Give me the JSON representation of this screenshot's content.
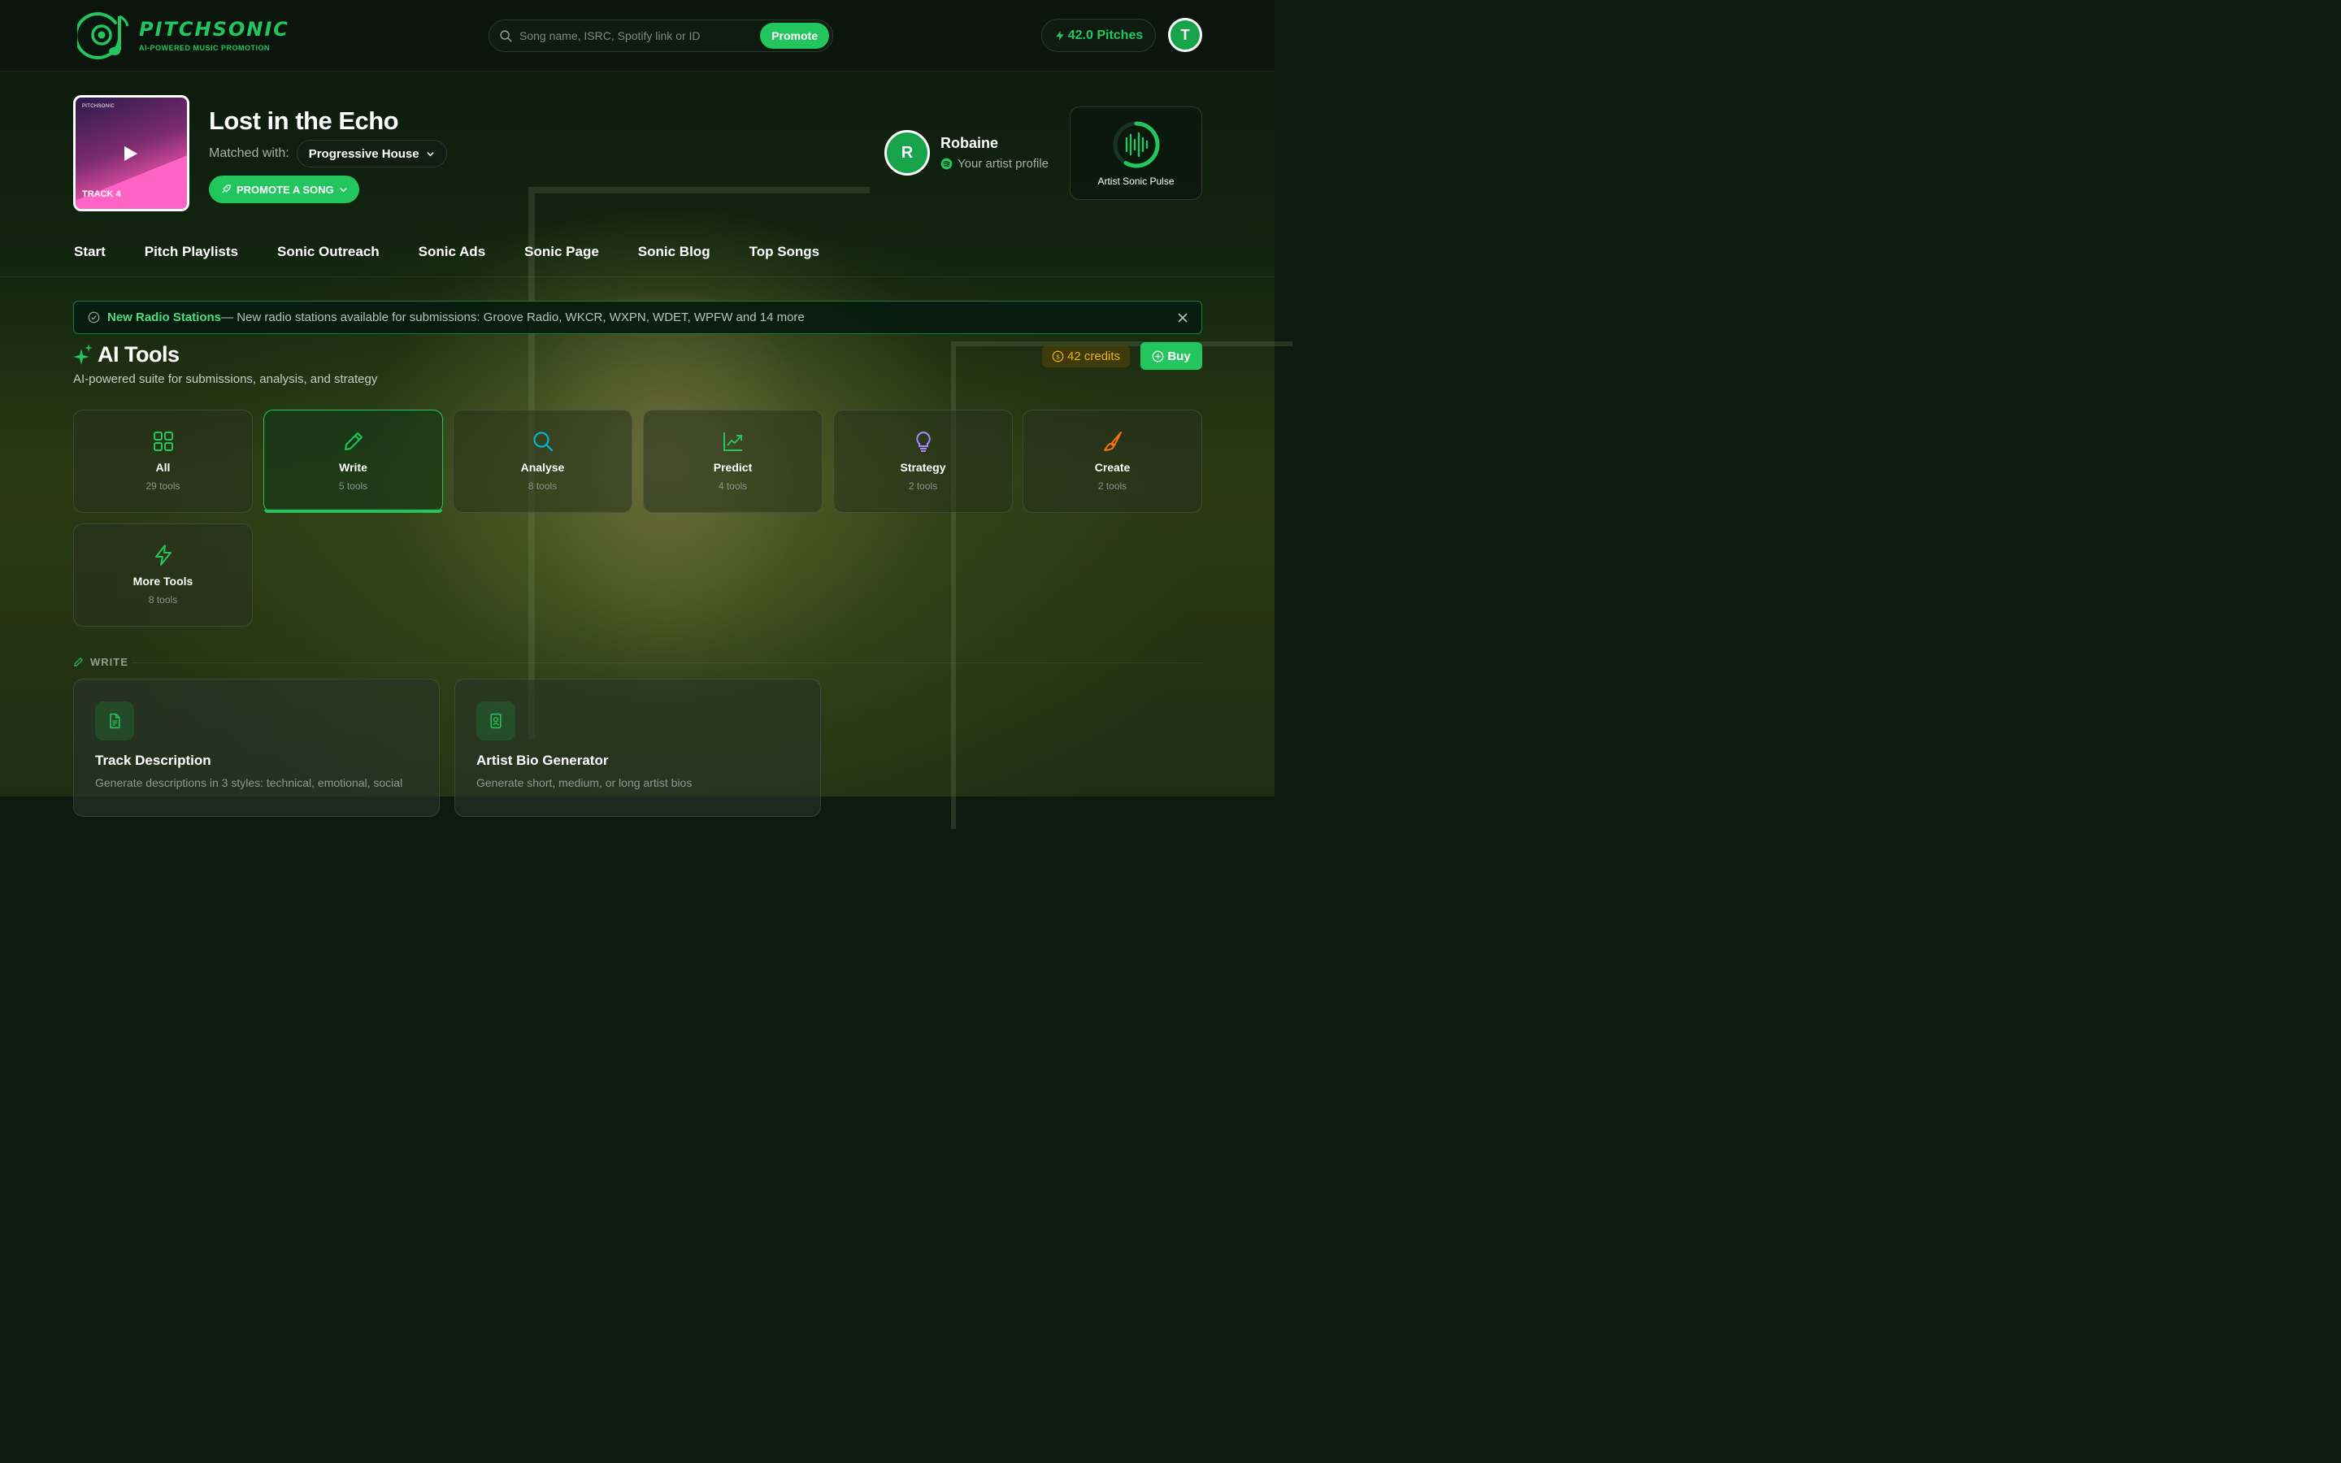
{
  "brand": {
    "name": "PITCHSONIC",
    "tagline": "AI-POWERED MUSIC PROMOTION"
  },
  "search": {
    "placeholder": "Song name, ISRC, Spotify link or ID",
    "button": "Promote"
  },
  "pitches": {
    "label": "42.0 Pitches"
  },
  "user": {
    "initial": "T"
  },
  "song": {
    "cover_brand": "PITCHSONIC",
    "cover_label": "TRACK 4",
    "title": "Lost in the Echo",
    "matched_label": "Matched with:",
    "genre": "Progressive House",
    "promote_label": "PROMOTE A SONG"
  },
  "artist": {
    "initial": "R",
    "name": "Robaine",
    "subtitle": "Your artist profile"
  },
  "pulse": {
    "label": "Artist Sonic Pulse"
  },
  "nav": [
    "Start",
    "Pitch Playlists",
    "Sonic Outreach",
    "Sonic Ads",
    "Sonic Page",
    "Sonic Blog",
    "Top Songs"
  ],
  "banner": {
    "title": "New Radio Stations",
    "text": " — New radio stations available for submissions: Groove Radio, WKCR, WXPN, WDET, WPFW and 14 more"
  },
  "ai_tools": {
    "title": "AI Tools",
    "subtitle": "AI-powered suite for submissions, analysis, and strategy",
    "credits": "42 credits",
    "buy": "Buy",
    "categories": [
      {
        "name": "All",
        "count": "29 tools",
        "icon": "grid-icon",
        "color": "#22c55e"
      },
      {
        "name": "Write",
        "count": "5 tools",
        "icon": "pencil-icon",
        "color": "#22c55e"
      },
      {
        "name": "Analyse",
        "count": "8 tools",
        "icon": "search-icon",
        "color": "#06b6d4"
      },
      {
        "name": "Predict",
        "count": "4 tools",
        "icon": "trend-icon",
        "color": "#22c55e"
      },
      {
        "name": "Strategy",
        "count": "2 tools",
        "icon": "bulb-icon",
        "color": "#a78bfa"
      },
      {
        "name": "Create",
        "count": "2 tools",
        "icon": "brush-icon",
        "color": "#f97316"
      },
      {
        "name": "More Tools",
        "count": "8 tools",
        "icon": "bolt-icon",
        "color": "#22c55e"
      }
    ],
    "section": "WRITE",
    "tools": [
      {
        "title": "Track Description",
        "desc": "Generate descriptions in 3 styles: technical, emotional, social"
      },
      {
        "title": "Artist Bio Generator",
        "desc": "Generate short, medium, or long artist bios"
      }
    ]
  }
}
